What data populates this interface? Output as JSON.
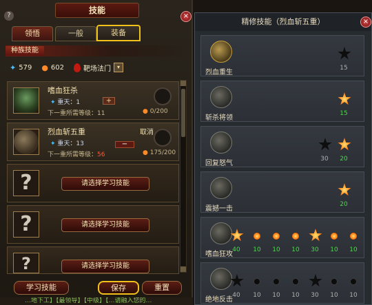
{
  "left_panel": {
    "title": "技能",
    "help": "?",
    "close": "×",
    "tabs": [
      "领悟",
      "一般",
      "装备"
    ],
    "race_skill_label": "种族技能",
    "resources": {
      "star_points": "579",
      "gem_points": "602",
      "school": "靶场法门",
      "select_arrow": "▾"
    },
    "slots": [
      {
        "name": "嗜血狂杀",
        "level_label": "重天：1",
        "req_label": "下一重所需等级：11",
        "progress": "0/200",
        "action": "+"
      },
      {
        "name": "烈血斩五重",
        "level_label": "重天：13",
        "req_prefix": "下一重所需等级：",
        "req_value": "56",
        "progress": "175/200",
        "action": "−",
        "cancel": "取消"
      },
      {
        "icon": "?",
        "button": "请选择学习技能"
      },
      {
        "icon": "?",
        "button": "请选择学习技能"
      },
      {
        "icon": "?",
        "button": "请选择学习技能"
      }
    ],
    "buttons": {
      "learn": "学习技能",
      "save": "保存",
      "reset": "重置"
    },
    "footer": "…地下工】【最领导】【中级】【…请融入您的…"
  },
  "right_panel": {
    "title": "精修技能（烈血斩五重）",
    "close": "×",
    "rows": [
      {
        "name": "烈血重生",
        "gold": true,
        "nodes": [
          {
            "state": "off",
            "shape": "spark",
            "level": "15",
            "color": "n"
          }
        ]
      },
      {
        "name": "斩杀将领",
        "gold": false,
        "nodes": [
          {
            "state": "on",
            "shape": "spark",
            "level": "15",
            "color": "g"
          }
        ]
      },
      {
        "name": "回复怒气",
        "gold": false,
        "nodes": [
          {
            "state": "off",
            "shape": "spark",
            "level": "30",
            "color": "n"
          },
          {
            "state": "on",
            "shape": "spark",
            "level": "20",
            "color": "g"
          }
        ]
      },
      {
        "name": "震撼一击",
        "gold": false,
        "nodes": [
          {
            "state": "on",
            "shape": "spark",
            "level": "20",
            "color": "g"
          }
        ]
      },
      {
        "name": "嗜血狂攻",
        "gold": false,
        "nodes": [
          {
            "state": "on",
            "shape": "spark",
            "level": "40",
            "color": "g"
          },
          {
            "state": "on",
            "shape": "dot",
            "level": "10",
            "color": "g"
          },
          {
            "state": "on",
            "shape": "dot",
            "level": "10",
            "color": "g"
          },
          {
            "state": "on",
            "shape": "dot",
            "level": "10",
            "color": "g"
          },
          {
            "state": "on",
            "shape": "spark",
            "level": "30",
            "color": "g"
          },
          {
            "state": "on",
            "shape": "dot",
            "level": "10",
            "color": "g"
          },
          {
            "state": "on",
            "shape": "dot",
            "level": "10",
            "color": "g"
          }
        ]
      },
      {
        "name": "绝地反击",
        "gold": false,
        "nodes": [
          {
            "state": "off",
            "shape": "spark",
            "level": "40",
            "color": "n"
          },
          {
            "state": "off",
            "shape": "dot",
            "level": "10",
            "color": "n"
          },
          {
            "state": "off",
            "shape": "dot",
            "level": "10",
            "color": "n"
          },
          {
            "state": "off",
            "shape": "dot",
            "level": "10",
            "color": "n"
          },
          {
            "state": "off",
            "shape": "spark",
            "level": "30",
            "color": "n"
          },
          {
            "state": "off",
            "shape": "dot",
            "level": "10",
            "color": "n"
          },
          {
            "state": "off",
            "shape": "dot",
            "level": "10",
            "color": "n"
          }
        ]
      }
    ]
  }
}
